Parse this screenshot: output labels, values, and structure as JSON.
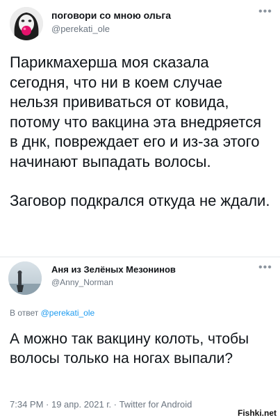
{
  "tweet": {
    "display_name": "поговори со мною ольга",
    "handle": "@perekati_ole",
    "more_icon": "ellipsis-icon",
    "paragraph_1": "Парикмахерша моя сказала сегодня, что ни в коем случае нельзя прививаться от ковида, потому что вакцина эта внедряется в днк, повреждает его и из-за этого начинают выпадать волосы.",
    "paragraph_2": "Заговор подкрался откуда не ждали."
  },
  "reply": {
    "display_name": "Аня из Зелёных Мезонинов",
    "handle": "@Anny_Norman",
    "more_icon": "ellipsis-icon",
    "replying_prefix": "В ответ",
    "replying_mention": "@perekati_ole",
    "text": "А можно так вакцину колоть, чтобы волосы только на ногах выпали?",
    "meta": "7:34 PM · 19 апр. 2021 г. · Twitter for Android"
  },
  "watermark": "Fishki.net",
  "colors": {
    "mention": "#1d9bf0",
    "secondary_text": "#6b7580"
  }
}
